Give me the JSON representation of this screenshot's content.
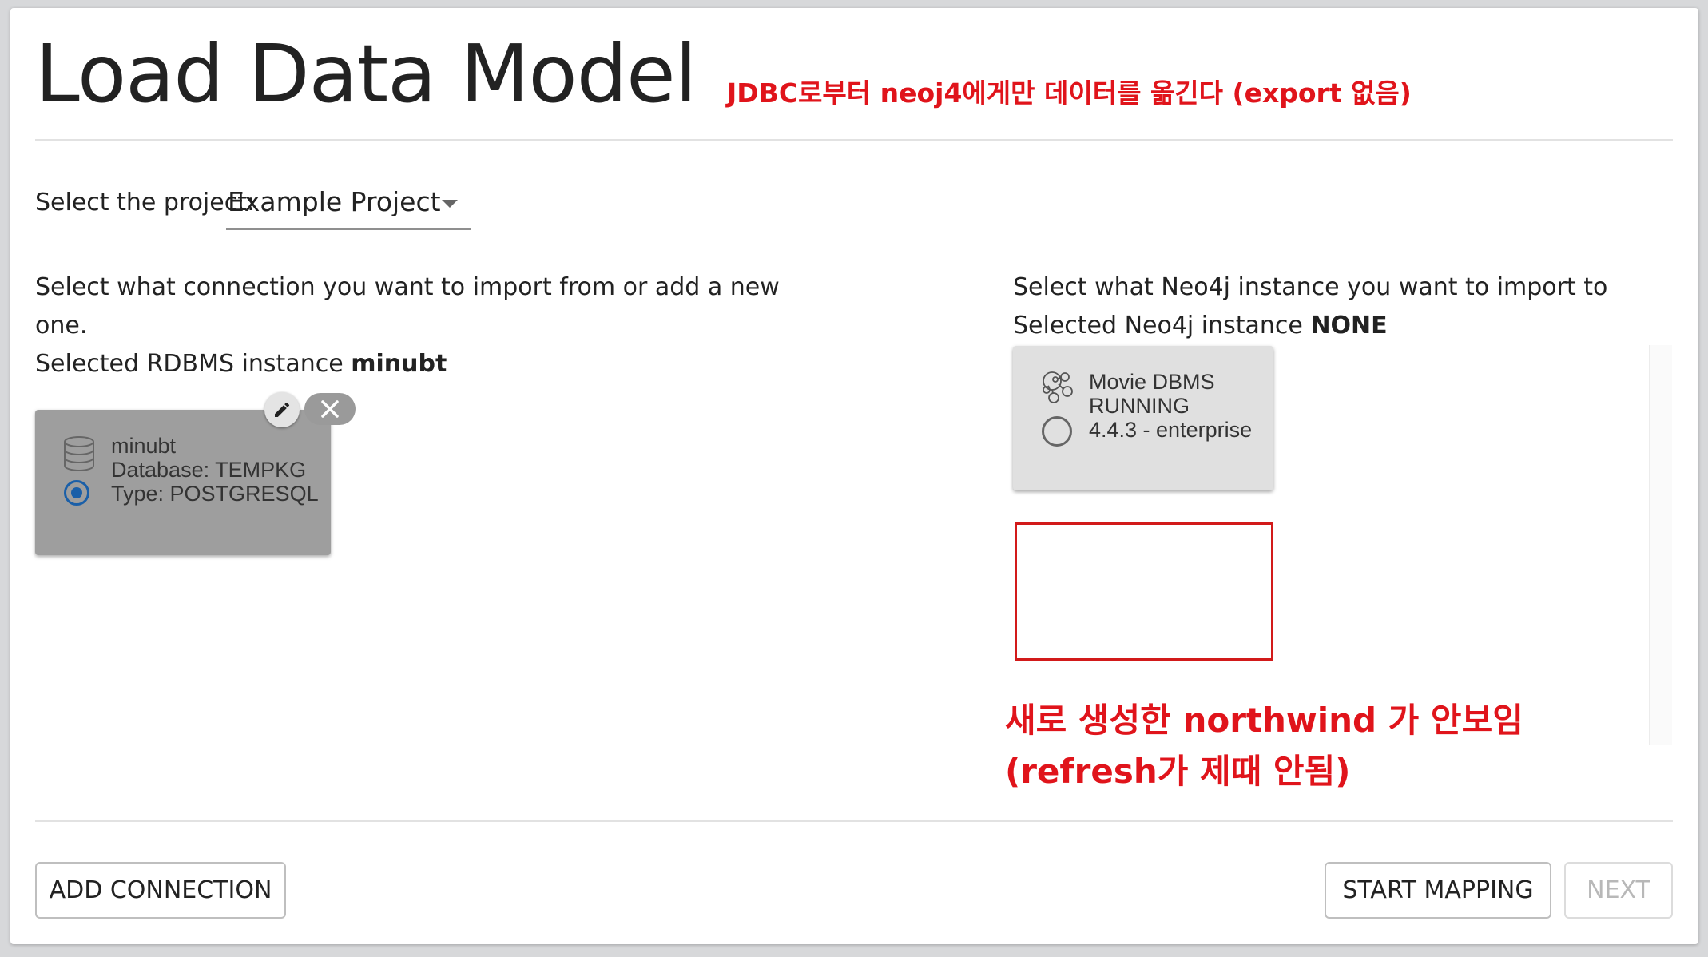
{
  "page": {
    "title": "Load Data Model",
    "annotation_top": "JDBC로부터 neoj4에게만 데이터를 옮긴다 (export 없음)"
  },
  "project": {
    "label": "Select the project:",
    "selected": "Example Project"
  },
  "rdbms": {
    "prompt_line1": "Select what connection you want to import from or add a new",
    "prompt_line2": "one.",
    "selected_label": "Selected RDBMS instance",
    "selected_value": "minubt",
    "card": {
      "icon": "database-icon",
      "name": "minubt",
      "database": "Database: TEMPKG",
      "type": "Type: POSTGRESQL",
      "selected": true
    }
  },
  "neo4j": {
    "prompt": "Select what Neo4j instance you want to import to",
    "selected_label": "Selected Neo4j instance",
    "selected_value": "NONE",
    "card": {
      "icon": "neo4j-graph-icon",
      "name": "Movie DBMS",
      "status": "RUNNING",
      "version": "4.4.3 - enterprise",
      "selected": false
    },
    "annotation_line1": "새로 생성한 northwind 가 안보임",
    "annotation_line2": "(refresh가 제때 안됨)"
  },
  "footer": {
    "add_connection": "ADD CONNECTION",
    "start_mapping": "START MAPPING",
    "next": "NEXT"
  },
  "colors": {
    "annotation_red": "#e0141b",
    "radio_blue": "#1a5fa8",
    "rdbms_card_bg": "#9e9e9e",
    "neo4j_card_bg": "#e0e0e0"
  }
}
